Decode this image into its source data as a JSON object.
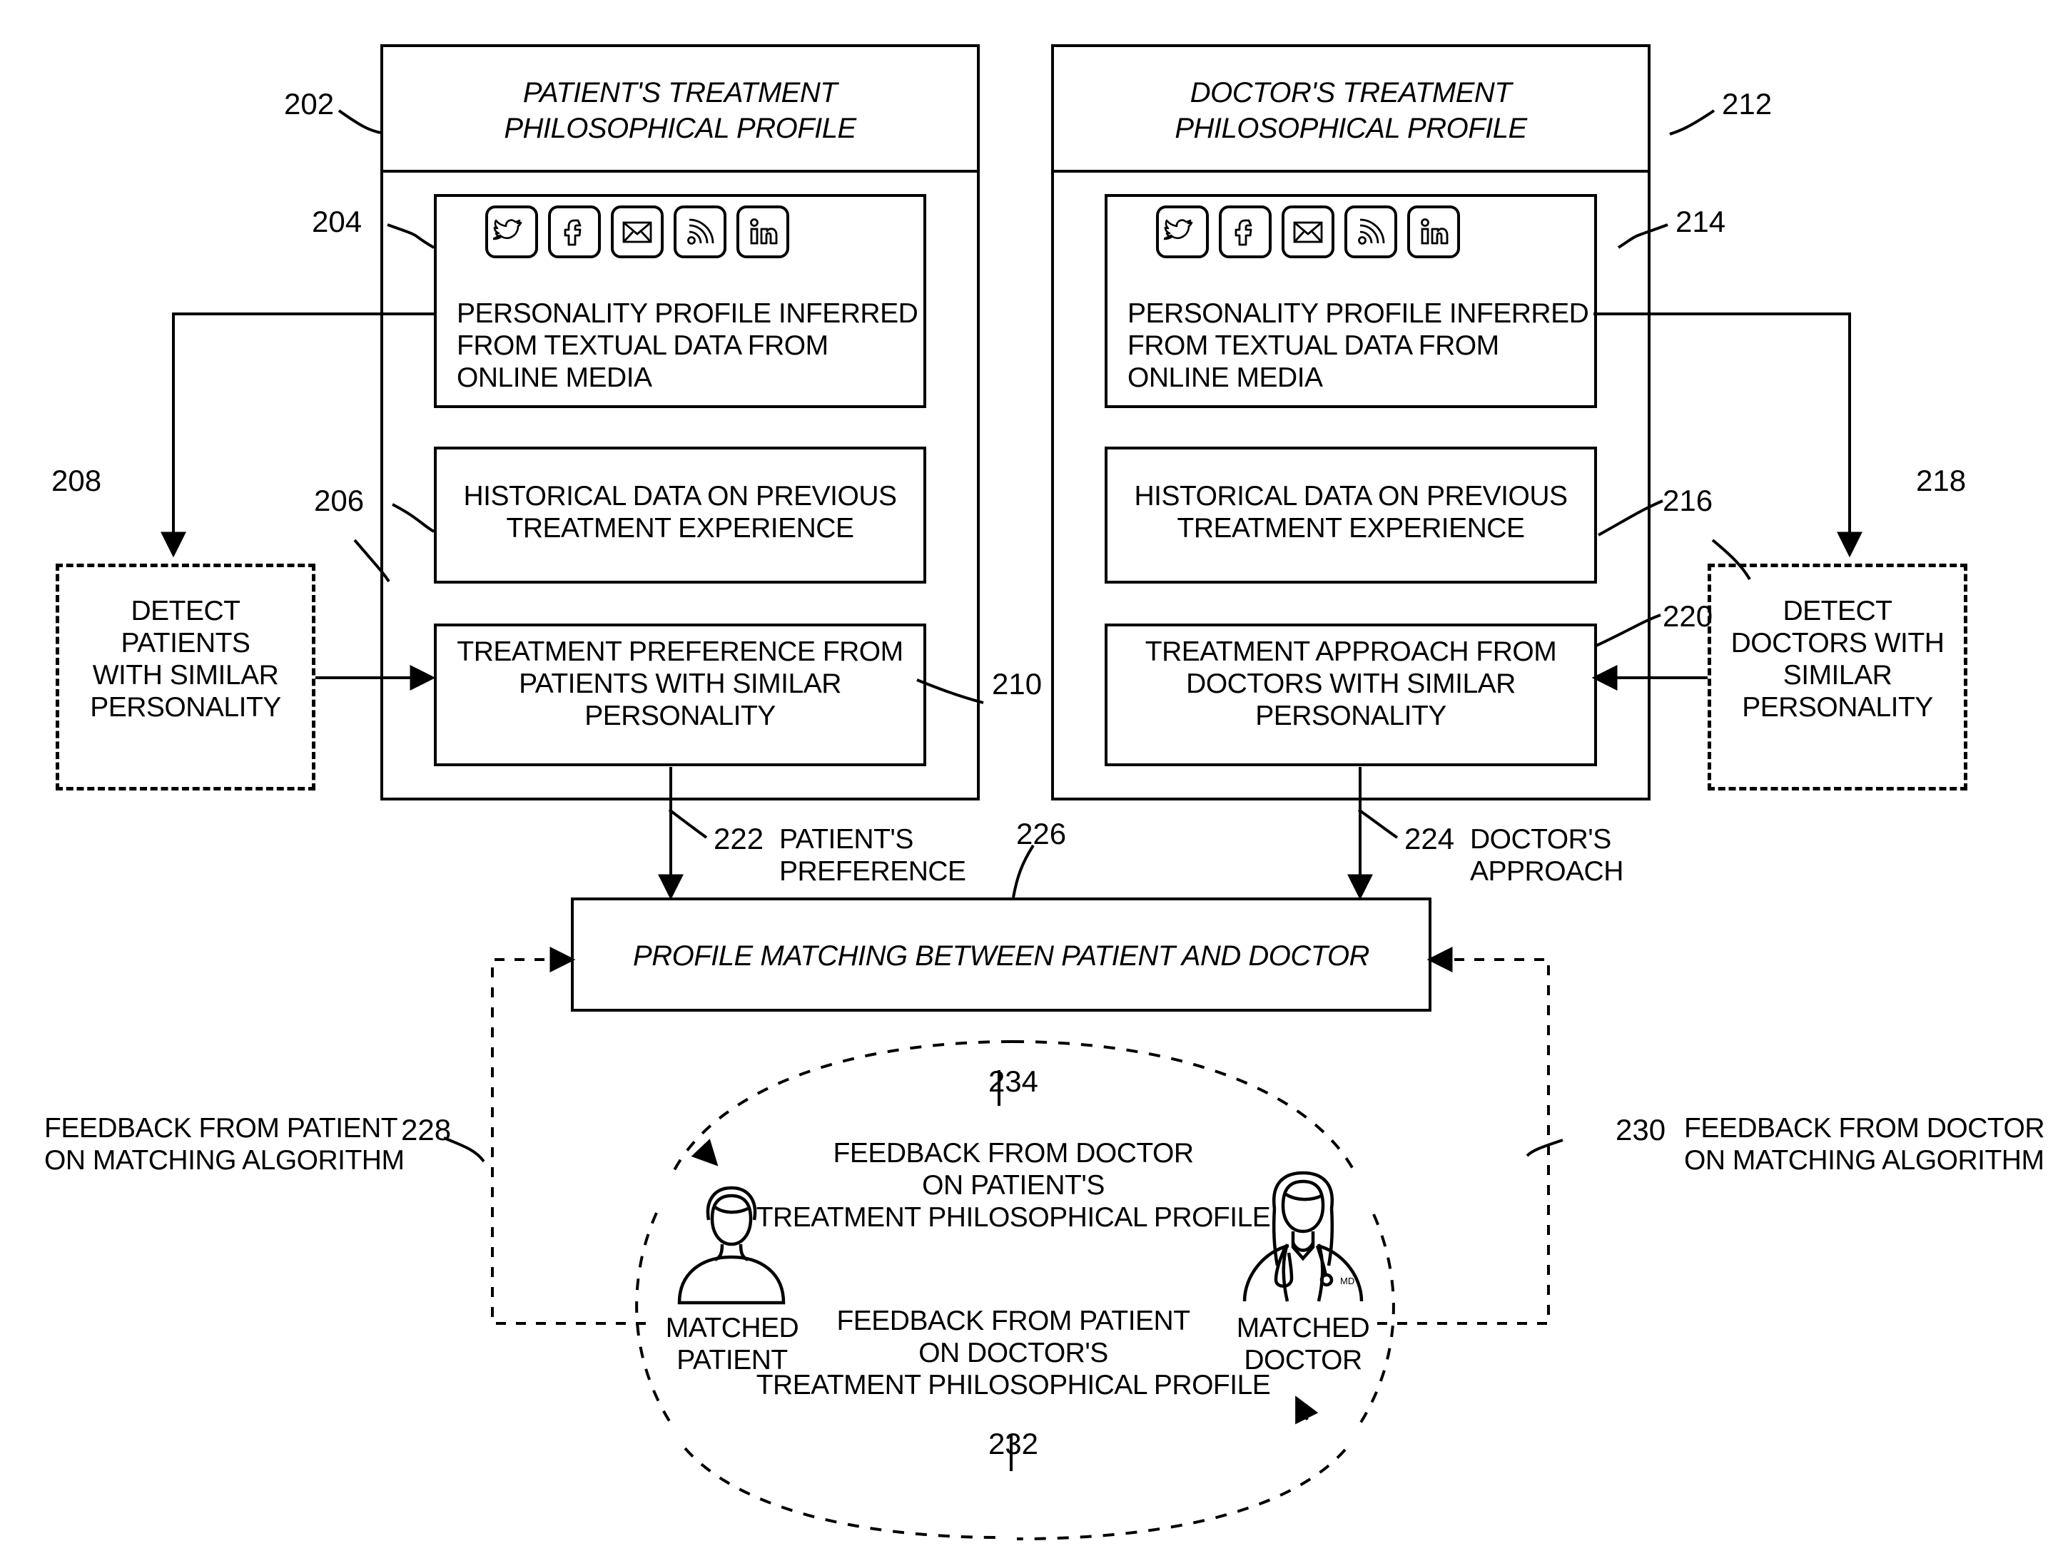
{
  "figure": {
    "type": "patent-flow-diagram",
    "left_panel": {
      "ref": "202",
      "title_line1": "PATIENT'S TREATMENT",
      "title_line2": "PHILOSOPHICAL PROFILE",
      "box_204": {
        "ref": "204",
        "icons": [
          "twitter-icon",
          "facebook-icon",
          "mail-icon",
          "rss-icon",
          "linkedin-icon"
        ],
        "line1": "PERSONALITY PROFILE INFERRED",
        "line2": "FROM TEXTUAL DATA FROM",
        "line3": "ONLINE MEDIA"
      },
      "box_206": {
        "ref": "206",
        "line1": "HISTORICAL DATA ON PREVIOUS",
        "line2": "TREATMENT EXPERIENCE"
      },
      "box_210": {
        "ref": "210",
        "line1": "TREATMENT PREFERENCE FROM",
        "line2": "PATIENTS WITH SIMILAR",
        "line3": "PERSONALITY"
      }
    },
    "right_panel": {
      "ref": "212",
      "title_line1": "DOCTOR'S TREATMENT",
      "title_line2": "PHILOSOPHICAL PROFILE",
      "box_214": {
        "ref": "214",
        "icons": [
          "twitter-icon",
          "facebook-icon",
          "mail-icon",
          "rss-icon",
          "linkedin-icon"
        ],
        "line1": "PERSONALITY PROFILE INFERRED",
        "line2": "FROM TEXTUAL DATA FROM",
        "line3": "ONLINE MEDIA"
      },
      "box_216": {
        "ref": "216",
        "line1": "HISTORICAL DATA ON PREVIOUS",
        "line2": "TREATMENT EXPERIENCE"
      },
      "box_220": {
        "ref": "220",
        "line1": "TREATMENT APPROACH FROM",
        "line2": "DOCTORS WITH SIMILAR",
        "line3": "PERSONALITY"
      }
    },
    "detect_patients": {
      "ref": "208",
      "line1": "DETECT",
      "line2": "PATIENTS",
      "line3": "WITH SIMILAR",
      "line4": "PERSONALITY"
    },
    "detect_doctors": {
      "ref": "218",
      "line1": "DETECT",
      "line2": "DOCTORS WITH",
      "line3": "SIMILAR",
      "line4": "PERSONALITY"
    },
    "arrow_222": {
      "ref": "222",
      "line1": "PATIENT'S",
      "line2": "PREFERENCE"
    },
    "arrow_224": {
      "ref": "224",
      "line1": "DOCTOR'S",
      "line2": "APPROACH"
    },
    "matching_box": {
      "ref": "226",
      "label": "PROFILE MATCHING BETWEEN PATIENT AND DOCTOR"
    },
    "feedback_left": {
      "ref": "228",
      "line1": "FEEDBACK FROM PATIENT",
      "line2": "ON MATCHING ALGORITHM"
    },
    "feedback_right": {
      "ref": "230",
      "line1": "FEEDBACK FROM DOCTOR",
      "line2": "ON MATCHING ALGORITHM"
    },
    "loop_top": {
      "ref": "234",
      "line1": "FEEDBACK FROM DOCTOR",
      "line2": "ON PATIENT'S",
      "line3": "TREATMENT PHILOSOPHICAL PROFILE"
    },
    "loop_bottom": {
      "ref": "232",
      "line1": "FEEDBACK FROM PATIENT",
      "line2": "ON DOCTOR'S",
      "line3": "TREATMENT PHILOSOPHICAL PROFILE"
    },
    "matched_patient": {
      "icon": "patient-avatar-icon",
      "line1": "MATCHED",
      "line2": "PATIENT"
    },
    "matched_doctor": {
      "icon": "doctor-avatar-icon",
      "line1": "MATCHED",
      "line2": "DOCTOR"
    },
    "colors": {
      "stroke": "#000000",
      "background": "#ffffff"
    }
  }
}
